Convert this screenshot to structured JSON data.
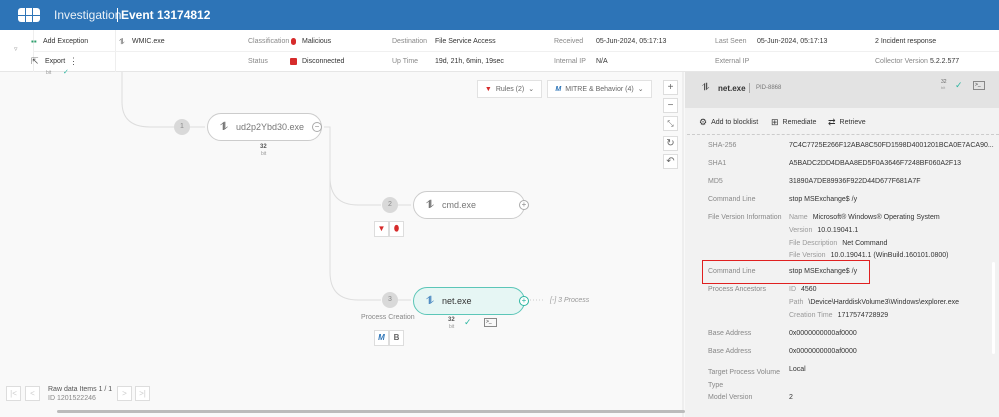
{
  "header": {
    "section": "Investigation",
    "title": "Event 13174812"
  },
  "info": {
    "add_exception": "Add Exception",
    "export": "Export",
    "process": "WMIC.exe",
    "classification_label": "Classification",
    "classification": "Malicious",
    "destination_label": "Destination",
    "destination": "File Service Access",
    "received_label": "Received",
    "received": "05-Jun-2024, 05:17:13",
    "last_seen_label": "Last Seen",
    "last_seen": "05-Jun-2024, 05:17:13",
    "incident": "2 Incident response",
    "status_label": "Status",
    "status": "Disconnected",
    "uptime_label": "Up Time",
    "uptime": "19d, 21h, 6min, 19sec",
    "internal_ip_label": "Internal IP",
    "internal_ip": "N/A",
    "external_ip_label": "External IP",
    "external_ip": "",
    "collector_label": "Collector Version",
    "collector": "5.2.2.577"
  },
  "graph": {
    "rules_btn": "Rules (2)",
    "mitre_btn": "MITRE & Behavior (4)",
    "nodes": [
      {
        "step": "1",
        "name": "ud2p2Ybd30.exe",
        "bits": "32",
        "bit_label": "bit"
      },
      {
        "step": "2",
        "name": "cmd.exe"
      },
      {
        "step": "3",
        "name": "net.exe",
        "bits": "32",
        "bit_label": "bit",
        "caption": "Process Creation",
        "more": "[-] 3 Process"
      }
    ],
    "tags": {
      "m": "M",
      "b": "B"
    },
    "footer": {
      "title": "Raw data Items 1 / 1",
      "id": "ID 1201522246"
    }
  },
  "panel": {
    "name": "net.exe",
    "pid": "PID-8868",
    "bits": "32",
    "bit_label": "bit",
    "actions": {
      "blocklist": "Add to blocklist",
      "remediate": "Remediate",
      "retrieve": "Retrieve"
    },
    "rows": [
      {
        "label": "SHA-256",
        "value": "7C4C7725E266F12ABA8C50FD1598D4001201BCA0E7ACA90..."
      },
      {
        "label": "SHA1",
        "value": "A5BADC2DD4DBAA8ED5F0A3646F7248BF060A2F13"
      },
      {
        "label": "MD5",
        "value": "31890A7DE89936F922D44D677F681A7F"
      },
      {
        "label": "Command Line",
        "value": "stop MSExchange$ /y"
      }
    ],
    "fvi": {
      "label": "File Version Information",
      "name_k": "Name",
      "name": "Microsoft® Windows® Operating System",
      "version_k": "Version",
      "version": "10.0.19041.1",
      "desc_k": "File Description",
      "desc": "Net Command",
      "fver_k": "File Version",
      "fver": "10.0.19041.1 (WinBuild.160101.0800)"
    },
    "cmd2": {
      "label": "Command Line",
      "value": "stop MSExchange$ /y"
    },
    "ancestors": {
      "label": "Process Ancestors",
      "id_k": "ID",
      "id": "4560",
      "path_k": "Path",
      "path": "\\Device\\HarddiskVolume3\\Windows\\explorer.exe",
      "ct_k": "Creation Time",
      "ct": "1717574728929"
    },
    "rows2": [
      {
        "label": "Base Address",
        "value": "0x0000000000af0000"
      },
      {
        "label": "Base Address",
        "value": "0x0000000000af0000"
      },
      {
        "label": "Target Process Volume Type",
        "value": "Local"
      },
      {
        "label": "Model Version",
        "value": "2"
      }
    ]
  },
  "colors": {
    "header": "#2d74b7",
    "malicious": "#d62b2b",
    "highlight": "#e02020",
    "teal": "#2bb5a0"
  }
}
